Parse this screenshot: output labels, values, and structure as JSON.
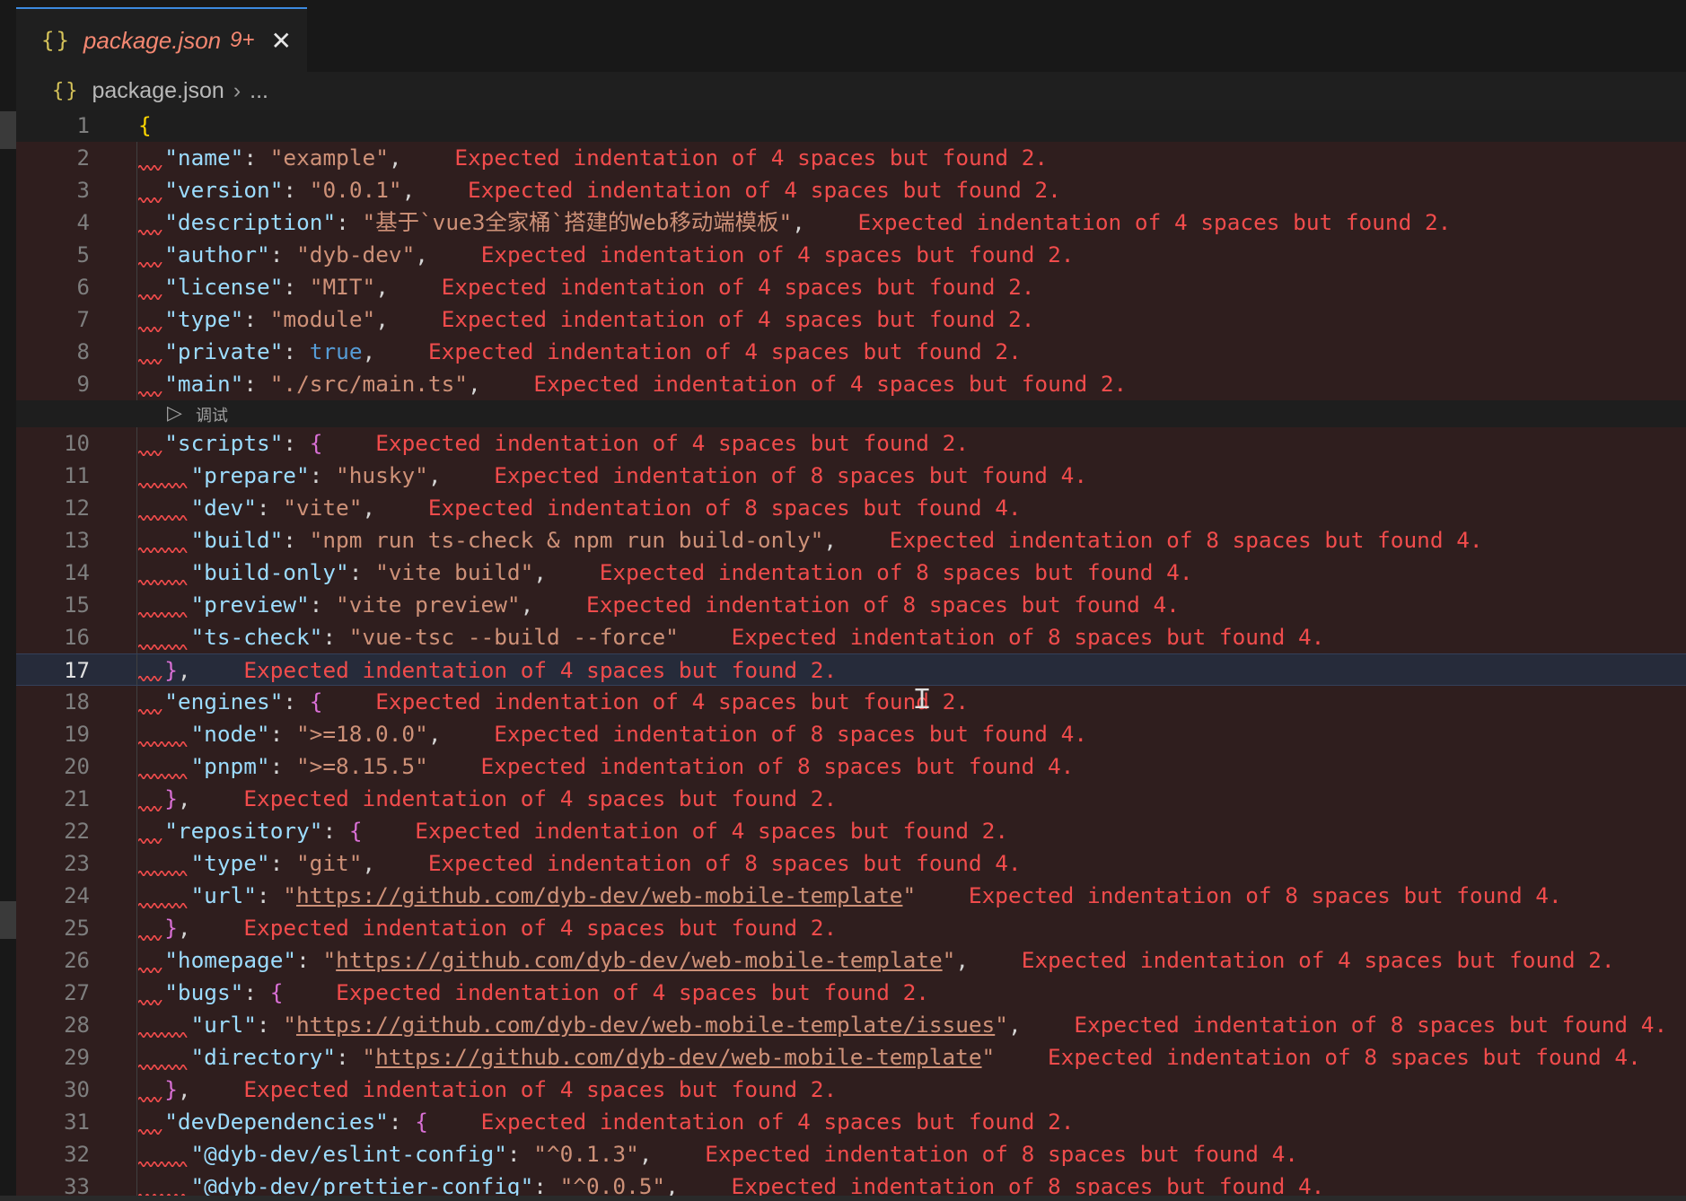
{
  "tab": {
    "icon": "{}",
    "title": "package.json",
    "badge": "9+",
    "close": "✕"
  },
  "breadcrumb": {
    "icon": "{}",
    "file": "package.json",
    "separator": "›",
    "more": "..."
  },
  "codelens": {
    "icon": "play-icon",
    "label": "调试"
  },
  "colors": {
    "key": "#9cdcfe",
    "string": "#ce9178",
    "boolean": "#569cd6",
    "bracket_outer": "#ffd700",
    "bracket_inner": "#da70d6",
    "diagnostic": "#f14c4c",
    "tab_accent": "#3c8ae0"
  },
  "lines": [
    {
      "n": "1",
      "parts": [
        [
          "br1",
          "{"
        ]
      ]
    },
    {
      "n": "2",
      "parts": [
        [
          "k",
          "\"name\""
        ],
        [
          "p",
          ": "
        ],
        [
          "s",
          "\"example\""
        ],
        [
          "p",
          ","
        ],
        [
          "m",
          "    Expected indentation of 4 spaces but found 2."
        ]
      ]
    },
    {
      "n": "3",
      "parts": [
        [
          "k",
          "\"version\""
        ],
        [
          "p",
          ": "
        ],
        [
          "s",
          "\"0.0.1\""
        ],
        [
          "p",
          ","
        ],
        [
          "m",
          "    Expected indentation of 4 spaces but found 2."
        ]
      ]
    },
    {
      "n": "4",
      "parts": [
        [
          "k",
          "\"description\""
        ],
        [
          "p",
          ": "
        ],
        [
          "s",
          "\"基于`vue3全家桶`搭建的Web移动端模板\""
        ],
        [
          "p",
          ","
        ],
        [
          "m",
          "    Expected indentation of 4 spaces but found 2."
        ]
      ]
    },
    {
      "n": "5",
      "parts": [
        [
          "k",
          "\"author\""
        ],
        [
          "p",
          ": "
        ],
        [
          "s",
          "\"dyb-dev\""
        ],
        [
          "p",
          ","
        ],
        [
          "m",
          "    Expected indentation of 4 spaces but found 2."
        ]
      ]
    },
    {
      "n": "6",
      "parts": [
        [
          "k",
          "\"license\""
        ],
        [
          "p",
          ": "
        ],
        [
          "s",
          "\"MIT\""
        ],
        [
          "p",
          ","
        ],
        [
          "m",
          "    Expected indentation of 4 spaces but found 2."
        ]
      ]
    },
    {
      "n": "7",
      "parts": [
        [
          "k",
          "\"type\""
        ],
        [
          "p",
          ": "
        ],
        [
          "s",
          "\"module\""
        ],
        [
          "p",
          ","
        ],
        [
          "m",
          "    Expected indentation of 4 spaces but found 2."
        ]
      ]
    },
    {
      "n": "8",
      "parts": [
        [
          "k",
          "\"private\""
        ],
        [
          "p",
          ": "
        ],
        [
          "b",
          "true"
        ],
        [
          "p",
          ","
        ],
        [
          "m",
          "    Expected indentation of 4 spaces but found 2."
        ]
      ]
    },
    {
      "n": "9",
      "parts": [
        [
          "k",
          "\"main\""
        ],
        [
          "p",
          ": "
        ],
        [
          "s",
          "\"./src/main.ts\""
        ],
        [
          "p",
          ","
        ],
        [
          "m",
          "    Expected indentation of 4 spaces but found 2."
        ]
      ]
    },
    {
      "n": "10",
      "parts": [
        [
          "k",
          "\"scripts\""
        ],
        [
          "p",
          ": "
        ],
        [
          "br2",
          "{"
        ],
        [
          "m",
          "    Expected indentation of 4 spaces but found 2."
        ]
      ]
    },
    {
      "n": "11",
      "parts": [
        [
          "k",
          "\"prepare\""
        ],
        [
          "p",
          ": "
        ],
        [
          "s",
          "\"husky\""
        ],
        [
          "p",
          ","
        ],
        [
          "m",
          "    Expected indentation of 8 spaces but found 4."
        ]
      ]
    },
    {
      "n": "12",
      "parts": [
        [
          "k",
          "\"dev\""
        ],
        [
          "p",
          ": "
        ],
        [
          "s",
          "\"vite\""
        ],
        [
          "p",
          ","
        ],
        [
          "m",
          "    Expected indentation of 8 spaces but found 4."
        ]
      ]
    },
    {
      "n": "13",
      "parts": [
        [
          "k",
          "\"build\""
        ],
        [
          "p",
          ": "
        ],
        [
          "s",
          "\"npm run ts-check & npm run build-only\""
        ],
        [
          "p",
          ","
        ],
        [
          "m",
          "    Expected indentation of 8 spaces but found 4."
        ]
      ]
    },
    {
      "n": "14",
      "parts": [
        [
          "k",
          "\"build-only\""
        ],
        [
          "p",
          ": "
        ],
        [
          "s",
          "\"vite build\""
        ],
        [
          "p",
          ","
        ],
        [
          "m",
          "    Expected indentation of 8 spaces but found 4."
        ]
      ]
    },
    {
      "n": "15",
      "parts": [
        [
          "k",
          "\"preview\""
        ],
        [
          "p",
          ": "
        ],
        [
          "s",
          "\"vite preview\""
        ],
        [
          "p",
          ","
        ],
        [
          "m",
          "    Expected indentation of 8 spaces but found 4."
        ]
      ]
    },
    {
      "n": "16",
      "parts": [
        [
          "k",
          "\"ts-check\""
        ],
        [
          "p",
          ": "
        ],
        [
          "s",
          "\"vue-tsc --build --force\""
        ],
        [
          "m",
          "    Expected indentation of 8 spaces but found 4."
        ]
      ]
    },
    {
      "n": "17",
      "parts": [
        [
          "br2",
          "}"
        ],
        [
          "p",
          ","
        ],
        [
          "m",
          "    Expected indentation of 4 spaces but found 2."
        ]
      ]
    },
    {
      "n": "18",
      "parts": [
        [
          "k",
          "\"engines\""
        ],
        [
          "p",
          ": "
        ],
        [
          "br2",
          "{"
        ],
        [
          "m",
          "    Expected indentation of 4 spaces but found 2."
        ]
      ]
    },
    {
      "n": "19",
      "parts": [
        [
          "k",
          "\"node\""
        ],
        [
          "p",
          ": "
        ],
        [
          "s",
          "\">=18.0.0\""
        ],
        [
          "p",
          ","
        ],
        [
          "m",
          "    Expected indentation of 8 spaces but found 4."
        ]
      ]
    },
    {
      "n": "20",
      "parts": [
        [
          "k",
          "\"pnpm\""
        ],
        [
          "p",
          ": "
        ],
        [
          "s",
          "\">=8.15.5\""
        ],
        [
          "m",
          "    Expected indentation of 8 spaces but found 4."
        ]
      ]
    },
    {
      "n": "21",
      "parts": [
        [
          "br2",
          "}"
        ],
        [
          "p",
          ","
        ],
        [
          "m",
          "    Expected indentation of 4 spaces but found 2."
        ]
      ]
    },
    {
      "n": "22",
      "parts": [
        [
          "k",
          "\"repository\""
        ],
        [
          "p",
          ": "
        ],
        [
          "br2",
          "{"
        ],
        [
          "m",
          "    Expected indentation of 4 spaces but found 2."
        ]
      ]
    },
    {
      "n": "23",
      "parts": [
        [
          "k",
          "\"type\""
        ],
        [
          "p",
          ": "
        ],
        [
          "s",
          "\"git\""
        ],
        [
          "p",
          ","
        ],
        [
          "m",
          "    Expected indentation of 8 spaces but found 4."
        ]
      ]
    },
    {
      "n": "24",
      "parts": [
        [
          "k",
          "\"url\""
        ],
        [
          "p",
          ": "
        ],
        [
          "s",
          "\""
        ],
        [
          "u",
          "https://github.com/dyb-dev/web-mobile-template"
        ],
        [
          "s",
          "\""
        ],
        [
          "m",
          "    Expected indentation of 8 spaces but found 4."
        ]
      ]
    },
    {
      "n": "25",
      "parts": [
        [
          "br2",
          "}"
        ],
        [
          "p",
          ","
        ],
        [
          "m",
          "    Expected indentation of 4 spaces but found 2."
        ]
      ]
    },
    {
      "n": "26",
      "parts": [
        [
          "k",
          "\"homepage\""
        ],
        [
          "p",
          ": "
        ],
        [
          "s",
          "\""
        ],
        [
          "u",
          "https://github.com/dyb-dev/web-mobile-template"
        ],
        [
          "s",
          "\""
        ],
        [
          "p",
          ","
        ],
        [
          "m",
          "    Expected indentation of 4 spaces but found 2."
        ]
      ]
    },
    {
      "n": "27",
      "parts": [
        [
          "k",
          "\"bugs\""
        ],
        [
          "p",
          ": "
        ],
        [
          "br2",
          "{"
        ],
        [
          "m",
          "    Expected indentation of 4 spaces but found 2."
        ]
      ]
    },
    {
      "n": "28",
      "parts": [
        [
          "k",
          "\"url\""
        ],
        [
          "p",
          ": "
        ],
        [
          "s",
          "\""
        ],
        [
          "u",
          "https://github.com/dyb-dev/web-mobile-template/issues"
        ],
        [
          "s",
          "\""
        ],
        [
          "p",
          ","
        ],
        [
          "m",
          "    Expected indentation of 8 spaces but found 4."
        ]
      ]
    },
    {
      "n": "29",
      "parts": [
        [
          "k",
          "\"directory\""
        ],
        [
          "p",
          ": "
        ],
        [
          "s",
          "\""
        ],
        [
          "u",
          "https://github.com/dyb-dev/web-mobile-template"
        ],
        [
          "s",
          "\""
        ],
        [
          "m",
          "    Expected indentation of 8 spaces but found 4."
        ]
      ]
    },
    {
      "n": "30",
      "parts": [
        [
          "br2",
          "}"
        ],
        [
          "p",
          ","
        ],
        [
          "m",
          "    Expected indentation of 4 spaces but found 2."
        ]
      ]
    },
    {
      "n": "31",
      "parts": [
        [
          "k",
          "\"devDependencies\""
        ],
        [
          "p",
          ": "
        ],
        [
          "br2",
          "{"
        ],
        [
          "m",
          "    Expected indentation of 4 spaces but found 2."
        ]
      ]
    },
    {
      "n": "32",
      "parts": [
        [
          "k",
          "\"@dyb-dev/eslint-config\""
        ],
        [
          "p",
          ": "
        ],
        [
          "s",
          "\"^0.1.3\""
        ],
        [
          "p",
          ","
        ],
        [
          "m",
          "    Expected indentation of 8 spaces but found 4."
        ]
      ]
    },
    {
      "n": "33",
      "parts": [
        [
          "k",
          "\"@dyb-dev/prettier-config\""
        ],
        [
          "p",
          ": "
        ],
        [
          "s",
          "\"^0.0.5\""
        ],
        [
          "p",
          ","
        ],
        [
          "m",
          "    Expected indentation of 8 spaces but found 4."
        ]
      ]
    }
  ]
}
